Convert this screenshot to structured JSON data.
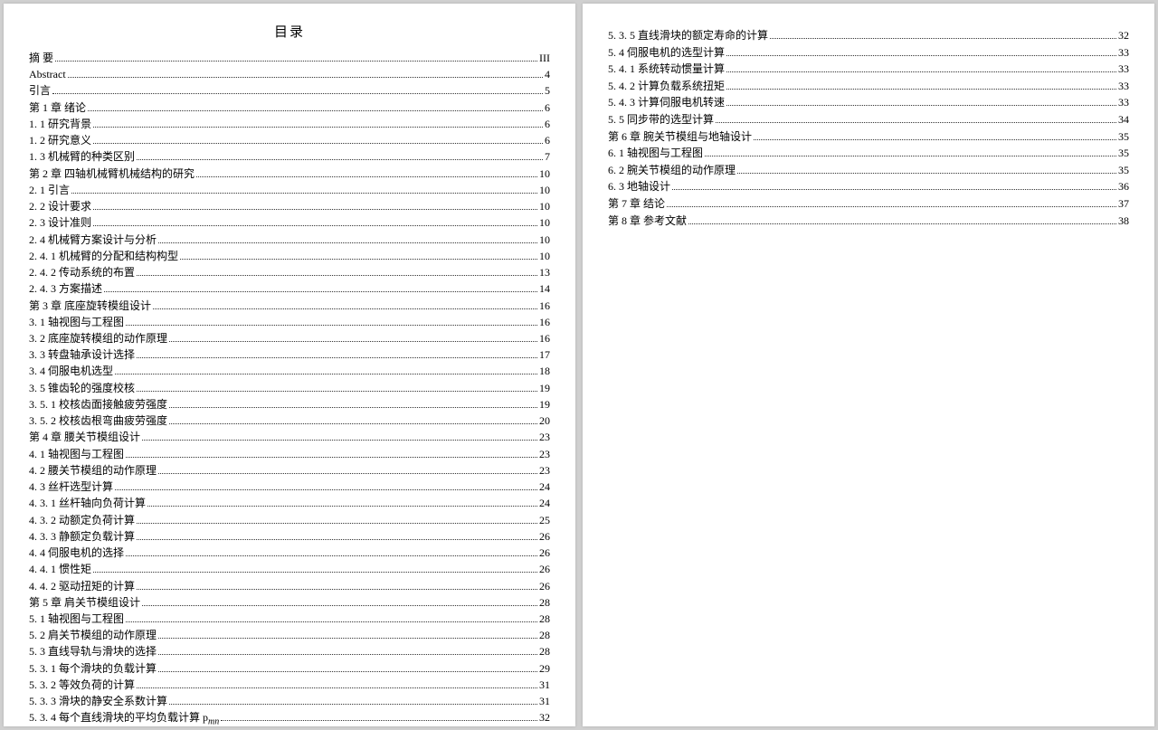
{
  "title": "目录",
  "page1": [
    {
      "label": "摘  要",
      "page": "III"
    },
    {
      "label": "Abstract",
      "page": "4"
    },
    {
      "label": "引言",
      "page": "5"
    },
    {
      "label": "第 1 章  绪论",
      "page": "6"
    },
    {
      "label": "1. 1  研究背景",
      "page": "6"
    },
    {
      "label": "1. 2  研究意义",
      "page": "6"
    },
    {
      "label": "1. 3  机械臂的种类区别",
      "page": "7"
    },
    {
      "label": "第 2 章  四轴机械臂机械结构的研究",
      "page": "10"
    },
    {
      "label": "2. 1  引言",
      "page": "10"
    },
    {
      "label": "2. 2  设计要求",
      "page": "10"
    },
    {
      "label": "2. 3  设计准则",
      "page": "10"
    },
    {
      "label": "2. 4  机械臂方案设计与分析",
      "page": "10"
    },
    {
      "label": "2. 4. 1  机械臂的分配和结构构型",
      "page": "10"
    },
    {
      "label": "2. 4. 2  传动系统的布置",
      "page": "13"
    },
    {
      "label": "2. 4. 3  方案描述",
      "page": "14"
    },
    {
      "label": "第 3 章  底座旋转模组设计",
      "page": "16"
    },
    {
      "label": "3. 1  轴视图与工程图",
      "page": "16"
    },
    {
      "label": "3. 2  底座旋转模组的动作原理",
      "page": "16"
    },
    {
      "label": "3. 3  转盘轴承设计选择",
      "page": "17"
    },
    {
      "label": "3. 4  伺服电机选型",
      "page": "18"
    },
    {
      "label": "3. 5  锥齿轮的强度校核",
      "page": "19"
    },
    {
      "label": "3. 5. 1  校核齿面接触疲劳强度",
      "page": "19"
    },
    {
      "label": "3. 5. 2  校核齿根弯曲疲劳强度",
      "page": "20"
    },
    {
      "label": "第 4 章  腰关节模组设计",
      "page": "23"
    },
    {
      "label": "4. 1  轴视图与工程图",
      "page": "23"
    },
    {
      "label": "4. 2  腰关节模组的动作原理",
      "page": "23"
    },
    {
      "label": "4. 3  丝杆选型计算",
      "page": "24"
    },
    {
      "label": "4. 3. 1  丝杆轴向负荷计算",
      "page": "24"
    },
    {
      "label": "4. 3. 2  动额定负荷计算",
      "page": "25"
    },
    {
      "label": "4. 3. 3  静额定负载计算",
      "page": "26"
    },
    {
      "label": "4. 4  伺服电机的选择",
      "page": "26"
    },
    {
      "label": "4. 4. 1  惯性矩",
      "page": "26"
    },
    {
      "label": "4. 4. 2  驱动扭矩的计算",
      "page": "26"
    },
    {
      "label": "第 5 章  肩关节模组设计",
      "page": "28"
    },
    {
      "label": "5. 1  轴视图与工程图",
      "page": "28"
    },
    {
      "label": "5. 2  肩关节模组的动作原理",
      "page": "28"
    },
    {
      "label": "5. 3  直线导轨与滑块的选择",
      "page": "28"
    },
    {
      "label": "5. 3. 1  每个滑块的负载计算",
      "page": "29"
    },
    {
      "label": "5. 3. 2  等效负荷的计算",
      "page": "31"
    },
    {
      "label": "5. 3. 3  滑块的静安全系数计算",
      "page": "31"
    },
    {
      "label": "5. 3. 4  每个直线滑块的平均负载计算 p",
      "page": "32",
      "sub": "mn"
    }
  ],
  "page2": [
    {
      "label": "5. 3. 5  直线滑块的额定寿命的计算",
      "page": "32"
    },
    {
      "label": "5. 4  伺服电机的选型计算",
      "page": "33"
    },
    {
      "label": "5. 4. 1  系统转动惯量计算",
      "page": "33"
    },
    {
      "label": "5. 4. 2  计算负载系统扭矩",
      "page": "33"
    },
    {
      "label": "5. 4. 3  计算伺服电机转速",
      "page": "33"
    },
    {
      "label": "5. 5  同步带的选型计算",
      "page": "34"
    },
    {
      "label": "第 6 章  腕关节模组与地轴设计",
      "page": "35"
    },
    {
      "label": "6. 1  轴视图与工程图",
      "page": "35"
    },
    {
      "label": "6. 2  腕关节模组的动作原理",
      "page": "35"
    },
    {
      "label": "6. 3  地轴设计",
      "page": "36"
    },
    {
      "label": "第 7 章  结论",
      "page": "37"
    },
    {
      "label": "第 8 章  参考文献",
      "page": "38"
    }
  ]
}
